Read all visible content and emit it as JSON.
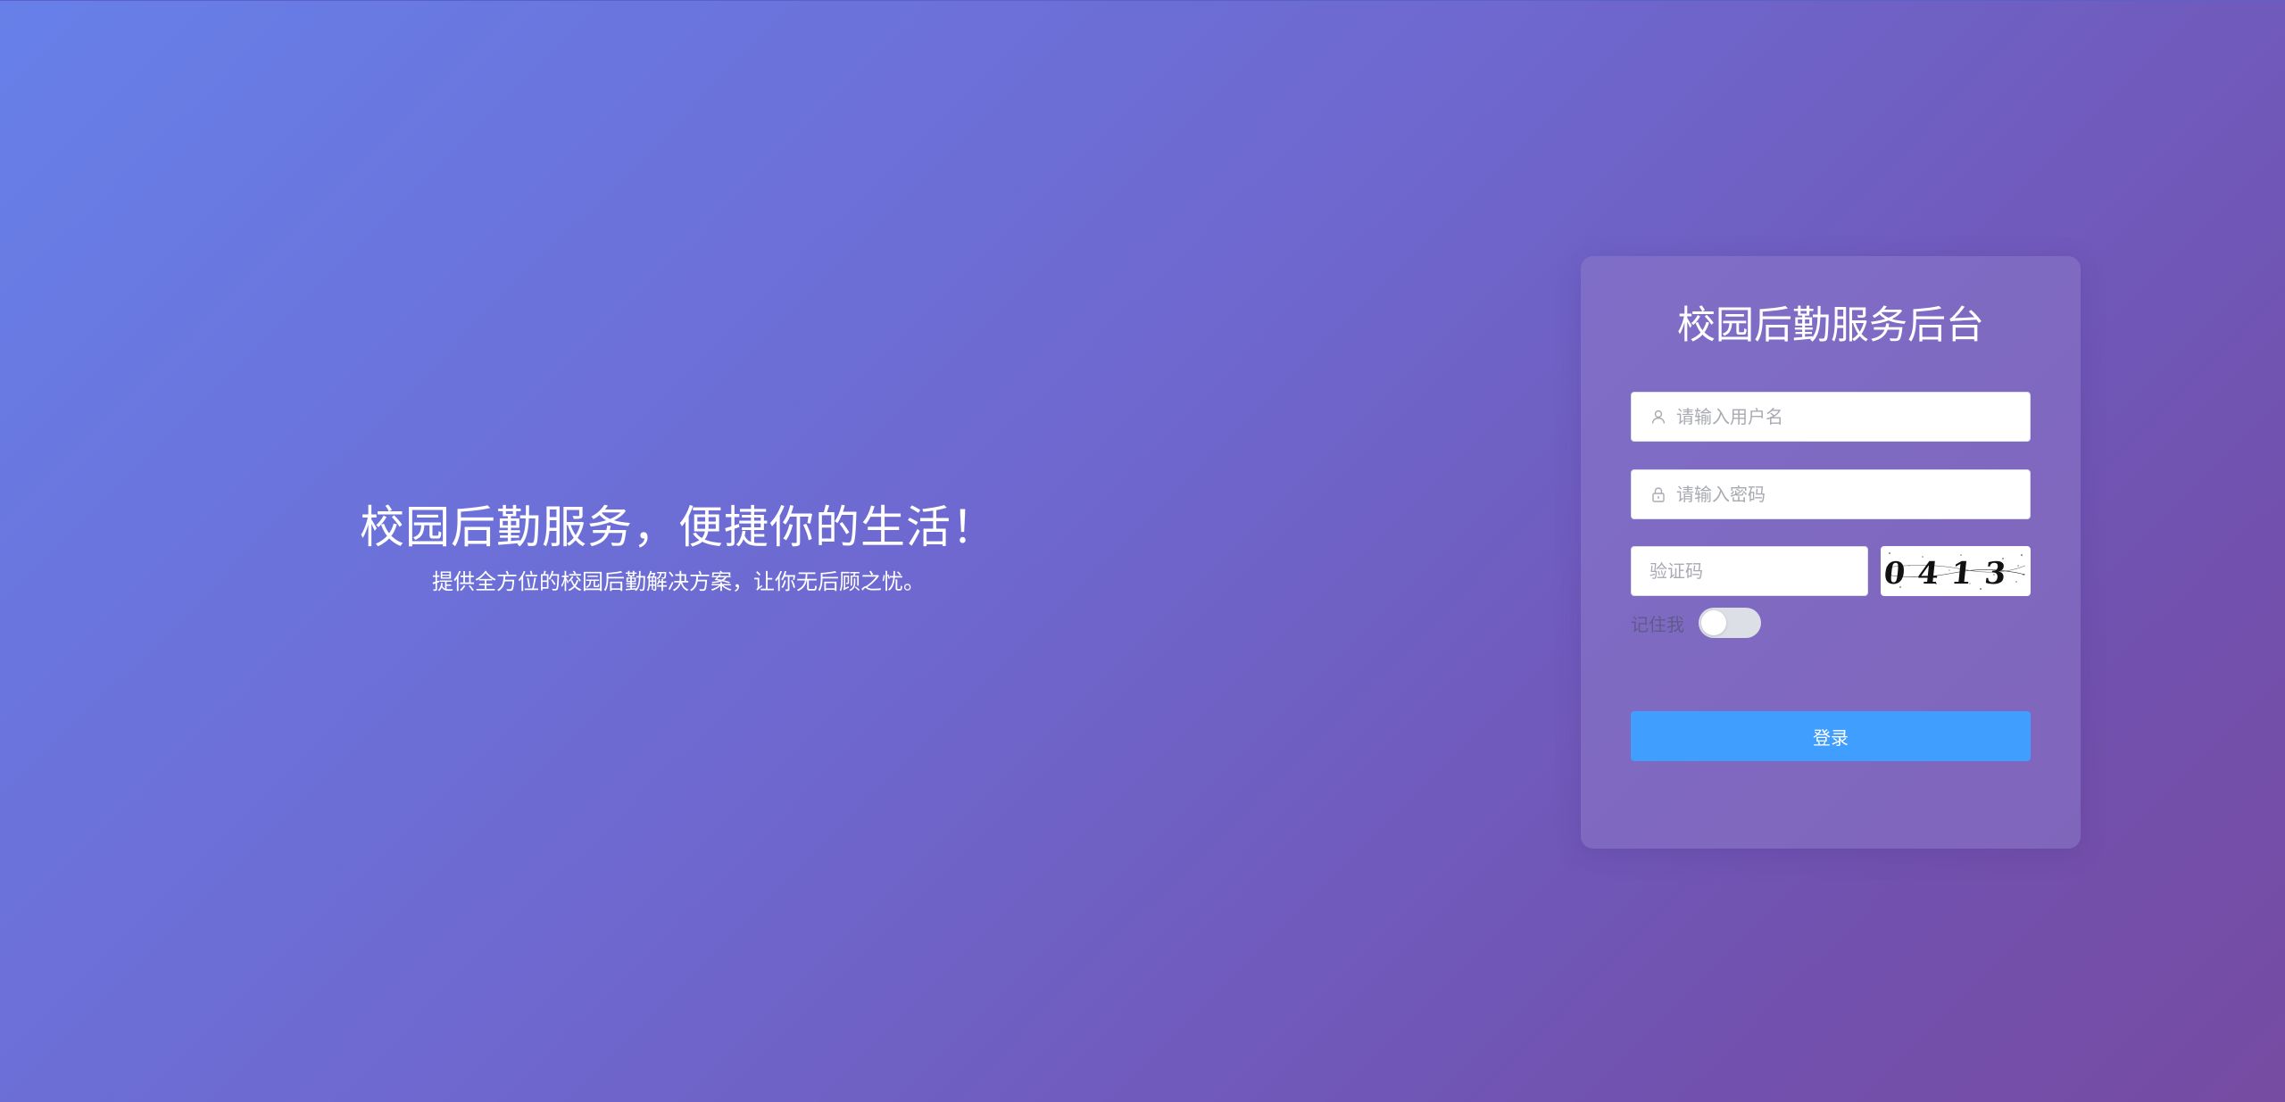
{
  "hero": {
    "title": "校园后勤服务，便捷你的生活！",
    "subtitle": "提供全方位的校园后勤解决方案，让你无后顾之忧。"
  },
  "login": {
    "title": "校园后勤服务后台",
    "username": {
      "placeholder": "请输入用户名",
      "value": "",
      "icon": "user-icon"
    },
    "password": {
      "placeholder": "请输入密码",
      "value": "",
      "icon": "lock-icon"
    },
    "captcha": {
      "placeholder": "验证码",
      "value": "",
      "image_text": "0413"
    },
    "remember": {
      "label": "记住我",
      "checked": false
    },
    "submit_label": "登录"
  },
  "colors": {
    "gradient_start": "#6780e9",
    "gradient_end": "#764ba2",
    "button": "#409eff",
    "card": "rgba(140,120,200,0.55)"
  }
}
